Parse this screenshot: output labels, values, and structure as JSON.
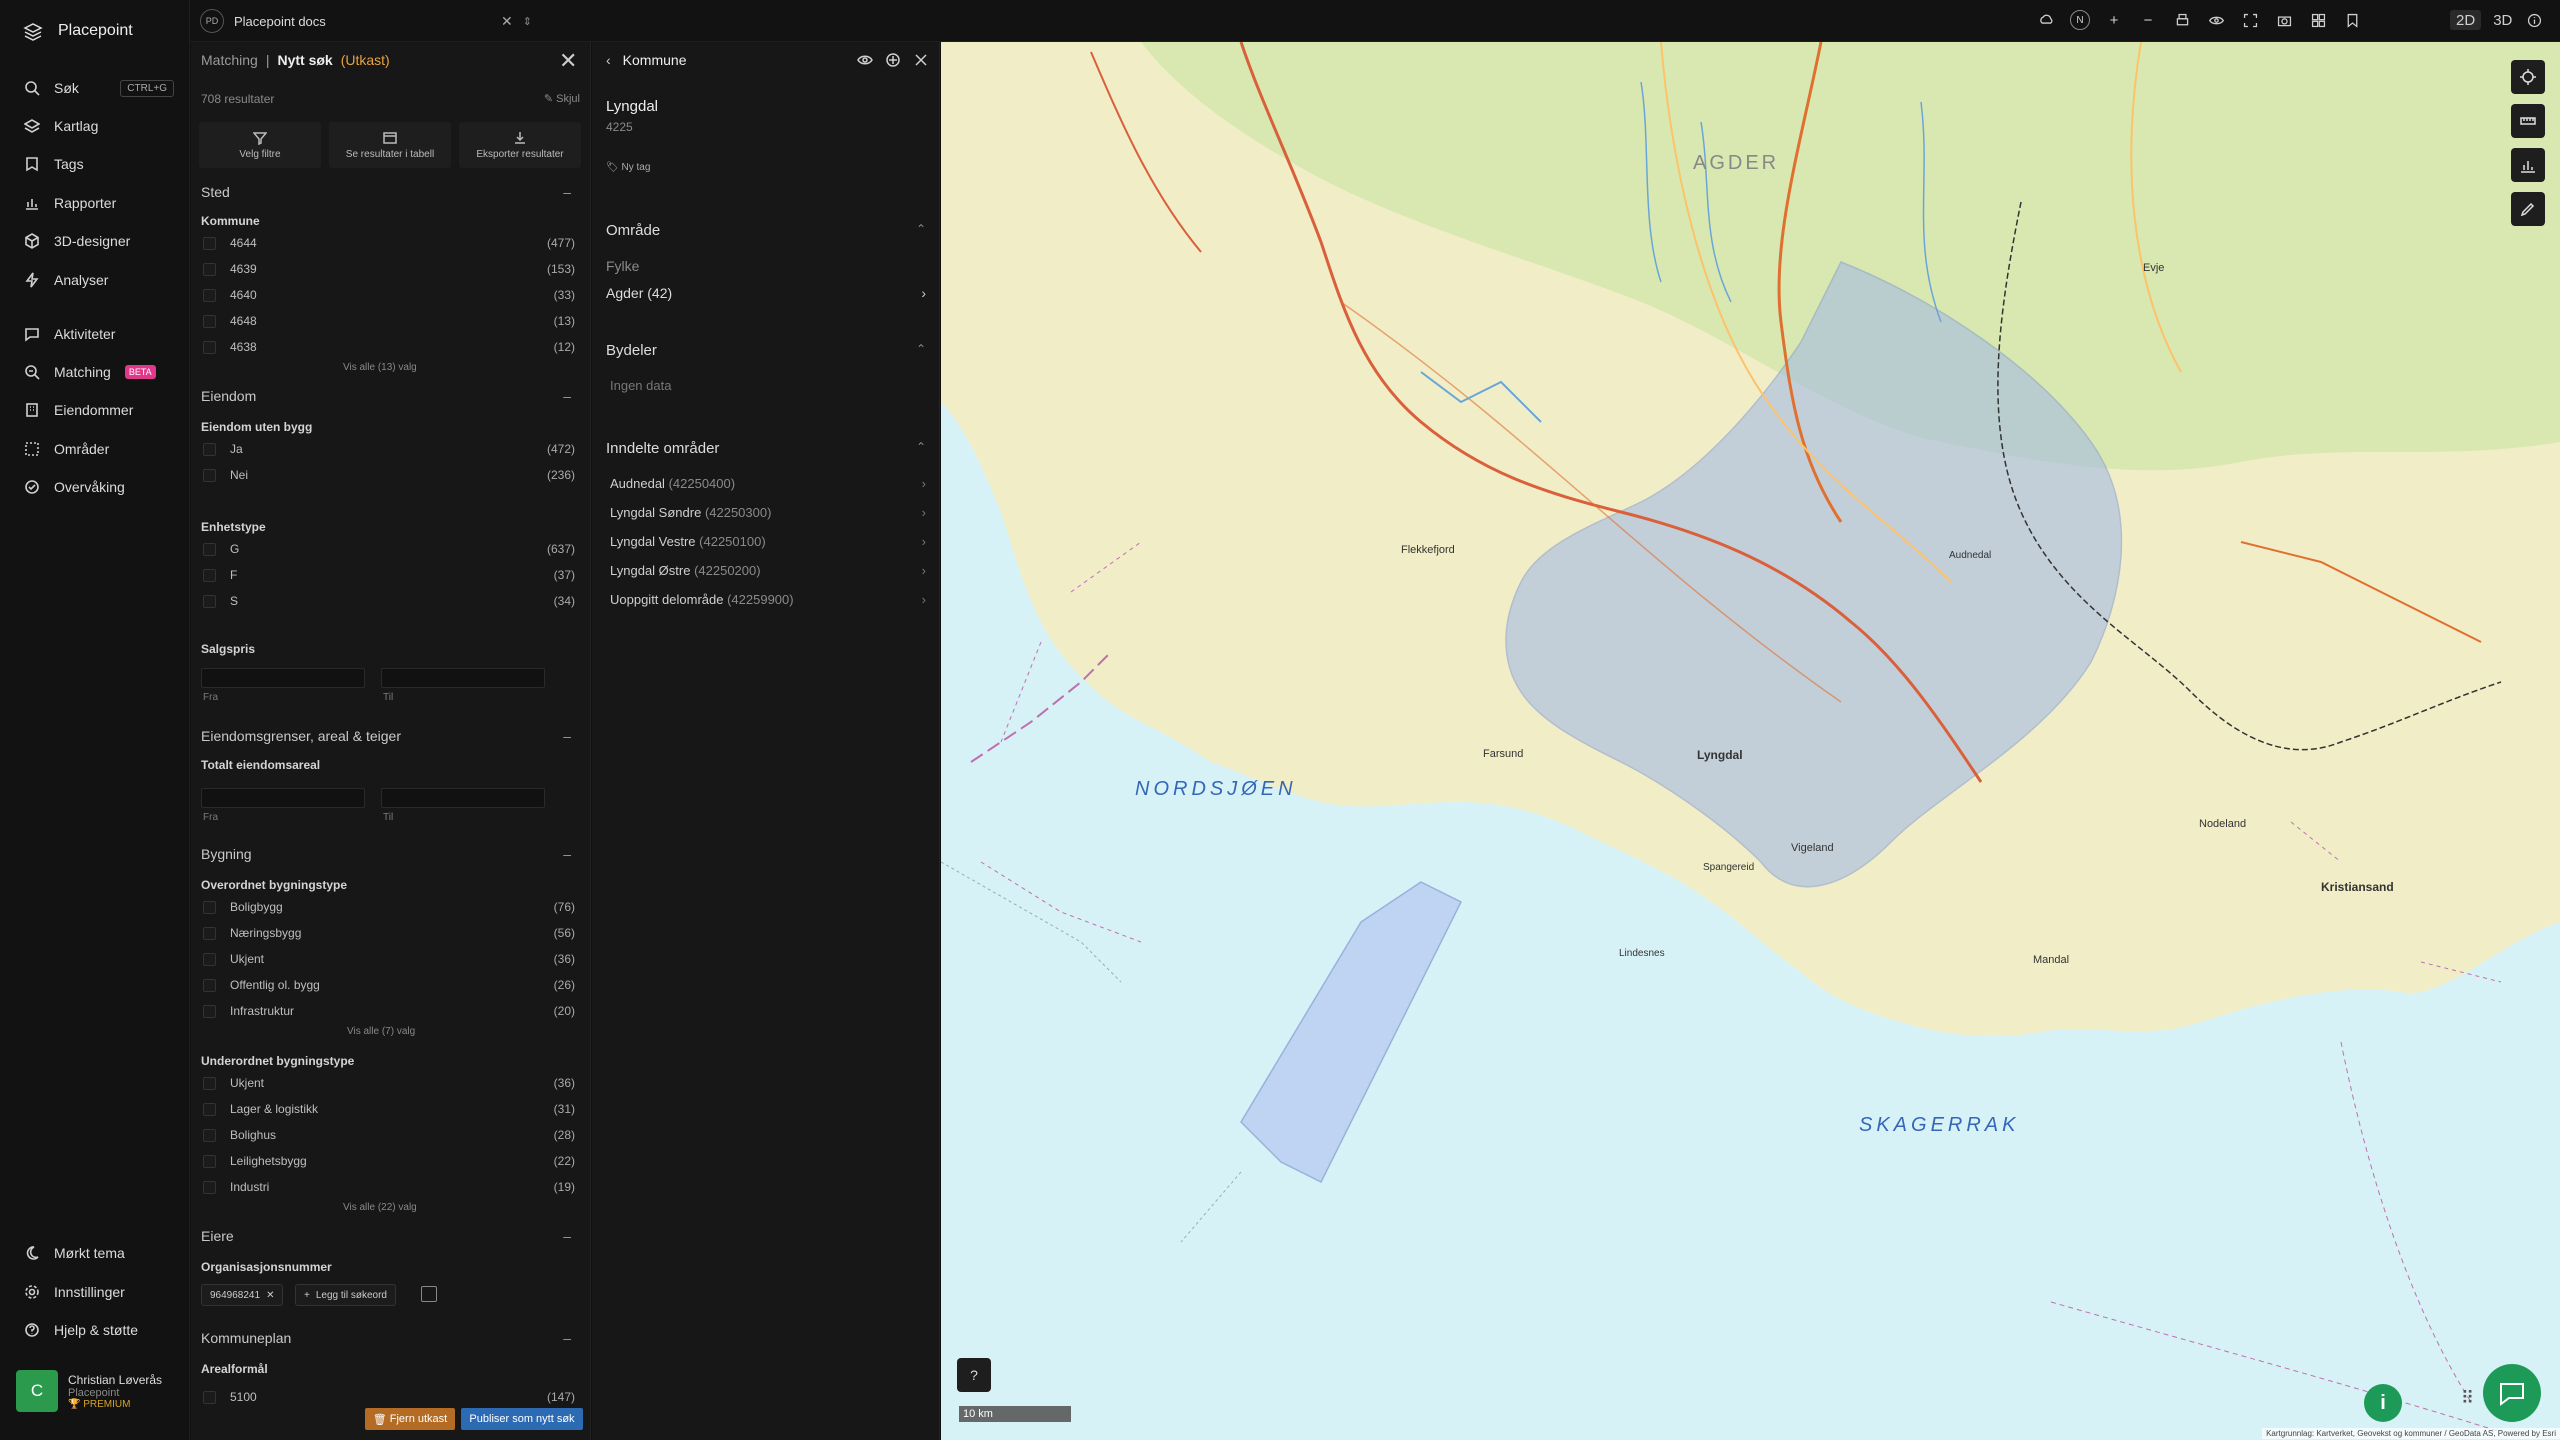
{
  "app": {
    "name": "Placepoint"
  },
  "sidebar": {
    "search": {
      "label": "Søk",
      "shortcut": "CTRL+G"
    },
    "items": [
      {
        "id": "kartlag",
        "label": "Kartlag"
      },
      {
        "id": "tags",
        "label": "Tags"
      },
      {
        "id": "rapporter",
        "label": "Rapporter"
      },
      {
        "id": "3d",
        "label": "3D-designer"
      },
      {
        "id": "analyser",
        "label": "Analyser"
      },
      {
        "id": "aktiviteter",
        "label": "Aktiviteter"
      },
      {
        "id": "matching",
        "label": "Matching",
        "badge": "BETA"
      },
      {
        "id": "eiendommer",
        "label": "Eiendommer"
      },
      {
        "id": "omrader",
        "label": "Områder"
      },
      {
        "id": "overvaking",
        "label": "Overvåking"
      }
    ],
    "bottom": [
      {
        "id": "tema",
        "label": "Mørkt tema"
      },
      {
        "id": "innstillinger",
        "label": "Innstillinger"
      },
      {
        "id": "hjelp",
        "label": "Hjelp & støtte"
      }
    ],
    "user": {
      "initial": "C",
      "name": "Christian Løverås",
      "org": "Placepoint",
      "plan": "PREMIUM"
    }
  },
  "topbar": {
    "doc_badge": "PD",
    "doc_name": "Placepoint docs",
    "compass": "N",
    "mode_2d": "2D",
    "mode_3d": "3D"
  },
  "filter": {
    "crumb": "Matching",
    "sep": "|",
    "title": "Nytt søk",
    "status": "(Utkast)",
    "results": "708 resultater",
    "hide": "Skjul",
    "tools": [
      "Velg filtre",
      "Se resultater i tabell",
      "Eksporter resultater"
    ],
    "sections": {
      "sted": "Sted",
      "kommune": "Kommune",
      "kommune_opts": [
        {
          "label": "4644",
          "count": "(477)"
        },
        {
          "label": "4639",
          "count": "(153)"
        },
        {
          "label": "4640",
          "count": "(33)"
        },
        {
          "label": "4648",
          "count": "(13)"
        },
        {
          "label": "4638",
          "count": "(12)"
        }
      ],
      "kommune_showall": "Vis alle (13) valg",
      "eiendom": "Eiendom",
      "uten_bygg": "Eiendom uten bygg",
      "uten_bygg_opts": [
        {
          "label": "Ja",
          "count": "(472)"
        },
        {
          "label": "Nei",
          "count": "(236)"
        }
      ],
      "enhetstype": "Enhetstype",
      "enhetstype_opts": [
        {
          "label": "G",
          "count": "(637)"
        },
        {
          "label": "F",
          "count": "(37)"
        },
        {
          "label": "S",
          "count": "(34)"
        }
      ],
      "salgspris": "Salgspris",
      "from": "Fra",
      "to": "Til",
      "grenser": "Eiendomsgrenser, areal & teiger",
      "totalareal": "Totalt eiendomsareal",
      "bygning": "Bygning",
      "overordnet": "Overordnet bygningstype",
      "overordnet_opts": [
        {
          "label": "Boligbygg",
          "count": "(76)"
        },
        {
          "label": "Næringsbygg",
          "count": "(56)"
        },
        {
          "label": "Ukjent",
          "count": "(36)"
        },
        {
          "label": "Offentlig ol. bygg",
          "count": "(26)"
        },
        {
          "label": "Infrastruktur",
          "count": "(20)"
        }
      ],
      "overordnet_showall": "Vis alle (7) valg",
      "underordnet": "Underordnet bygningstype",
      "underordnet_opts": [
        {
          "label": "Ukjent",
          "count": "(36)"
        },
        {
          "label": "Lager & logistikk",
          "count": "(31)"
        },
        {
          "label": "Bolighus",
          "count": "(28)"
        },
        {
          "label": "Leilighetsbygg",
          "count": "(22)"
        },
        {
          "label": "Industri",
          "count": "(19)"
        }
      ],
      "underordnet_showall": "Vis alle (22) valg",
      "eiere": "Eiere",
      "orgnr": "Organisasjonsnummer",
      "orgnr_chip": "964968241",
      "add_keyword": "Legg til søkeord",
      "kommuneplan": "Kommuneplan",
      "arealformal": "Arealformål",
      "arealformal_opts": [
        {
          "label": "5100",
          "count": "(147)"
        }
      ]
    },
    "remove_draft": "Fjern utkast",
    "publish": "Publiser som nytt søk"
  },
  "area": {
    "header": "Kommune",
    "name": "Lyngdal",
    "code": "4225",
    "new_tag": "Ny tag",
    "omrade": "Område",
    "fylke_label": "Fylke",
    "fylke_value": "Agder (42)",
    "bydeler": "Bydeler",
    "ingen": "Ingen data",
    "inndelte": "Inndelte områder",
    "subareas": [
      {
        "name": "Audnedal",
        "code": "(42250400)"
      },
      {
        "name": "Lyngdal Søndre",
        "code": "(42250300)"
      },
      {
        "name": "Lyngdal Vestre",
        "code": "(42250100)"
      },
      {
        "name": "Lyngdal Østre",
        "code": "(42250200)"
      },
      {
        "name": "Uoppgitt delområde",
        "code": "(42259900)"
      }
    ]
  },
  "map": {
    "labels": {
      "agder": "AGDER",
      "nordsjoen": "NORDSJØEN",
      "skagerrak": "SKAGERRAK",
      "lyngdal": "Lyngdal",
      "kristiansand": "Kristiansand",
      "mandal": "Mandal",
      "flekkefjord": "Flekkefjord",
      "farsund": "Farsund",
      "vigeland": "Vigeland",
      "nodeland": "Nodeland",
      "lindesnes": "Lindesnes",
      "audnedal": "Audnedal",
      "spangereid": "Spangereid",
      "evje": "Evje"
    },
    "scale": "10 km",
    "help": "?",
    "info": "i",
    "attribution": "Kartgrunnlag: Kartverket, Geovekst og kommuner / GeoData AS, Powered by Esri",
    "colors": {
      "land": "#f3efc8",
      "water": "#d7f2f7",
      "forest": "#cfe6a8",
      "highlight": "#9fb6e6",
      "road": "#d9603b"
    }
  }
}
